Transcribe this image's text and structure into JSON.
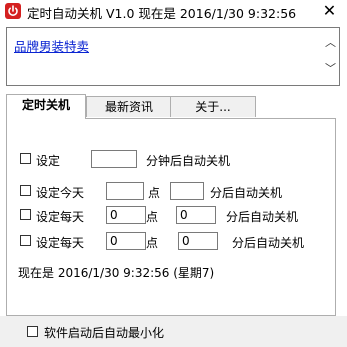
{
  "window": {
    "title": "定时自动关机 V1.0 现在是 2016/1/30 9:32:56",
    "close_label": "✕"
  },
  "banner": {
    "link_text": "品牌男装特卖",
    "scroll_up": "︿",
    "scroll_down": "﹀"
  },
  "tabs": [
    {
      "label": "定时关机",
      "active": true
    },
    {
      "label": "最新资讯",
      "active": false
    },
    {
      "label": "关于...",
      "active": false
    }
  ],
  "panel": {
    "row1": {
      "label": "设定",
      "value": "",
      "suffix": "分钟后自动关机"
    },
    "row2": {
      "label": "设定今天",
      "hour": "",
      "hour_unit": "点",
      "minute": "",
      "suffix": "分后自动关机"
    },
    "row3": {
      "label": "设定每天",
      "hour": "0",
      "hour_unit": "点",
      "minute": "0",
      "suffix": "分后自动关机"
    },
    "row4": {
      "label": "设定每天",
      "hour": "0",
      "hour_unit": "点",
      "minute": "0",
      "suffix": "分后自动关机"
    },
    "status": "现在是 2016/1/30 9:32:56 (星期7)"
  },
  "footer": {
    "auto_minimize_label": "软件启动后自动最小化"
  },
  "colors": {
    "accent_red": "#d42020",
    "link_blue": "#0a24d2",
    "footer_bg": "#f0f0f0"
  }
}
